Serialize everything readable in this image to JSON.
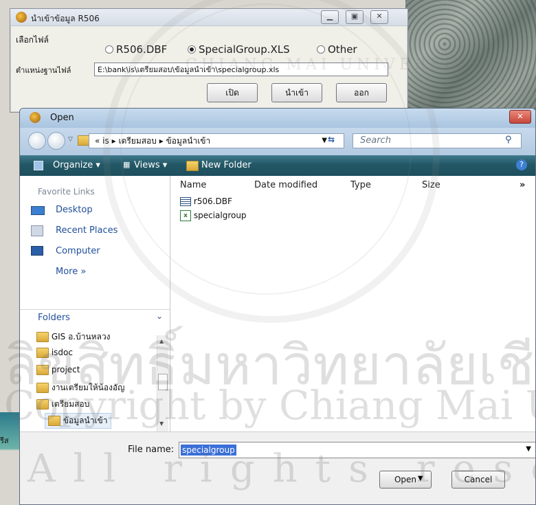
{
  "r506_dialog": {
    "title": "นำเข้าข้อมูล R506",
    "file_select_label": "เลือกไฟล์",
    "radio_options": [
      "R506.DBF",
      "SpecialGroup.XLS",
      "Other"
    ],
    "selected_option": "SpecialGroup.XLS",
    "path_label": "ตำแหน่งฐานไฟล์",
    "path_value": "E:\\bank\\is\\เตรียมสอบ\\ข้อมูลนำเข้า\\specialgroup.xls",
    "buttons": {
      "open": "เปิด",
      "import": "นำเข้า",
      "exit": "ออก"
    }
  },
  "open_dialog": {
    "title": "Open",
    "breadcrumb": [
      "«",
      "is",
      "▸",
      "เตรียมสอบ",
      "▸",
      "ข้อมูลนำเข้า"
    ],
    "search_placeholder": "Search",
    "toolbar": {
      "organize": "Organize",
      "views": "Views",
      "new_folder": "New Folder"
    },
    "favorite_links_header": "Favorite Links",
    "favorites": [
      "Desktop",
      "Recent Places",
      "Computer"
    ],
    "more": "More »",
    "folders_header": "Folders",
    "folders": [
      "GIS อ.บ้านหลวง",
      "isdoc",
      "project",
      "งานเตรียมให้น้องอัญ",
      "เตรียมสอบ",
      "ข้อมูลนำเข้า"
    ],
    "columns": [
      "Name",
      "Date modified",
      "Type",
      "Size",
      "»"
    ],
    "files": [
      {
        "name": "r506.DBF",
        "icon": "table-file-icon"
      },
      {
        "name": "specialgroup",
        "icon": "excel-file-icon"
      }
    ],
    "file_name_label": "File name:",
    "file_name_value": "specialgroup",
    "open_button": "Open",
    "cancel_button": "Cancel"
  },
  "watermark": {
    "line1": "ลิขสิทธิ์มหาวิทยาลัยเชียงใหม่",
    "line2": "Copyright by Chiang Mai University",
    "line3": "All rights reserved",
    "seal_text": "CHIANG MAI UNIVERSITY"
  },
  "colors": {
    "toolbar": "#235766",
    "selection": "#3a6fd8",
    "link": "#1f4e9a"
  }
}
